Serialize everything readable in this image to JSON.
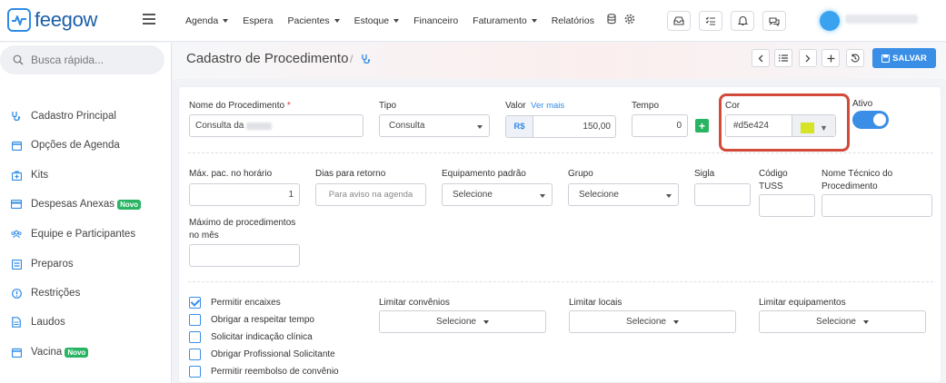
{
  "app": {
    "logo_text": "feegow",
    "brand_color": "#2f8be6"
  },
  "topnav": [
    {
      "label": "Agenda",
      "dropdown": true
    },
    {
      "label": "Espera",
      "dropdown": false
    },
    {
      "label": "Pacientes",
      "dropdown": true
    },
    {
      "label": "Estoque",
      "dropdown": true
    },
    {
      "label": "Financeiro",
      "dropdown": false
    },
    {
      "label": "Faturamento",
      "dropdown": true
    },
    {
      "label": "Relatórios",
      "dropdown": false
    }
  ],
  "sidebar": {
    "search_placeholder": "Busca rápida...",
    "items": [
      {
        "label": "Cadastro Principal",
        "icon": "stethoscope-icon"
      },
      {
        "label": "Opções de Agenda",
        "icon": "calendar-icon"
      },
      {
        "label": "Kits",
        "icon": "kit-icon"
      },
      {
        "label": "Despesas Anexas",
        "icon": "card-icon",
        "badge": "Novo"
      },
      {
        "label": "Equipe e Participantes",
        "icon": "users-icon"
      },
      {
        "label": "Preparos",
        "icon": "list-icon"
      },
      {
        "label": "Restrições",
        "icon": "alert-icon"
      },
      {
        "label": "Laudos",
        "icon": "document-icon"
      },
      {
        "label": "Vacina",
        "icon": "calendar-icon",
        "badge": "Novo"
      }
    ]
  },
  "page": {
    "title": "Cadastro de Procedimento",
    "breadcrumb_sep": "/",
    "save_label": "SALVAR"
  },
  "form": {
    "nome": {
      "label": "Nome do Procedimento",
      "required_mark": "*",
      "value": "Consulta da"
    },
    "tipo": {
      "label": "Tipo",
      "value": "Consulta"
    },
    "valor": {
      "label": "Valor",
      "link": "Ver mais",
      "prefix": "R$",
      "value": "150,00"
    },
    "tempo": {
      "label": "Tempo",
      "value": "0"
    },
    "cor": {
      "label": "Cor",
      "value": "#d5e424",
      "swatch": "#d5e424"
    },
    "ativo": {
      "label": "Ativo",
      "on": true
    },
    "max_pac": {
      "label": "Máx. pac. no horário",
      "value": "1"
    },
    "dias_retorno": {
      "label": "Dias para retorno",
      "placeholder": "Para aviso na agenda"
    },
    "equipamento": {
      "label": "Equipamento padrão",
      "value": "Selecione"
    },
    "grupo": {
      "label": "Grupo",
      "value": "Selecione"
    },
    "sigla": {
      "label": "Sigla",
      "value": ""
    },
    "tuss": {
      "label_1": "Código",
      "label_2": "TUSS",
      "value": ""
    },
    "nome_tecnico": {
      "label_1": "Nome Técnico do",
      "label_2": "Procedimento",
      "value": ""
    },
    "max_mes": {
      "label_1": "Máximo de procedimentos",
      "label_2": "no mês",
      "value": ""
    },
    "checkboxes": [
      {
        "label": "Permitir encaixes",
        "checked": true
      },
      {
        "label": "Obrigar a respeitar tempo",
        "checked": false
      },
      {
        "label": "Solicitar indicação clínica",
        "checked": false
      },
      {
        "label": "Obrigar Profissional Solicitante",
        "checked": false
      },
      {
        "label": "Permitir reembolso de convênio",
        "checked": false
      }
    ],
    "limitar_convenios": {
      "label": "Limitar convênios",
      "value": "Selecione"
    },
    "limitar_locais": {
      "label": "Limitar locais",
      "value": "Selecione"
    },
    "limitar_equipamentos": {
      "label": "Limitar equipamentos",
      "value": "Selecione"
    }
  }
}
